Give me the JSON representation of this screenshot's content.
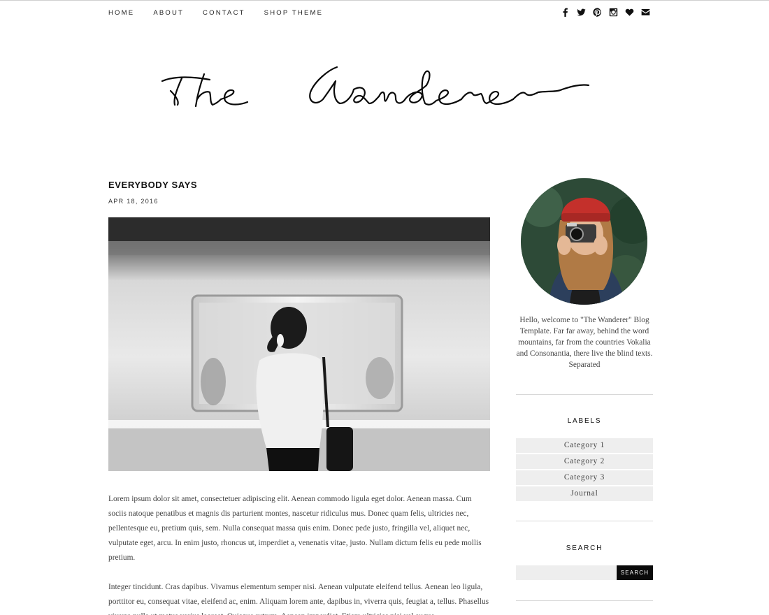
{
  "nav": {
    "items": [
      {
        "label": "HOME"
      },
      {
        "label": "ABOUT"
      },
      {
        "label": "CONTACT"
      },
      {
        "label": "SHOP THEME"
      }
    ],
    "social_icons": [
      "facebook-icon",
      "twitter-icon",
      "pinterest-icon",
      "instagram-icon",
      "heart-icon",
      "email-icon"
    ]
  },
  "blog": {
    "title": "The Wanderer"
  },
  "post": {
    "title": "EVERYBODY SAYS",
    "date": "APR 18, 2016",
    "image": "woman-at-subway-platform-photo",
    "paragraphs": [
      "Lorem ipsum dolor sit amet, consectetuer adipiscing elit. Aenean commodo ligula eget dolor. Aenean massa. Cum sociis natoque penatibus et magnis dis parturient montes, nascetur ridiculus mus. Donec quam felis, ultricies nec, pellentesque eu, pretium quis, sem. Nulla consequat massa quis enim. Donec pede justo, fringilla vel, aliquet nec, vulputate eget, arcu. In enim justo, rhoncus ut, imperdiet a, venenatis vitae, justo. Nullam dictum felis eu pede mollis pretium.",
      "Integer tincidunt. Cras dapibus. Vivamus elementum semper nisi. Aenean vulputate eleifend tellus. Aenean leo ligula, porttitor eu, consequat vitae, eleifend ac, enim. Aliquam lorem ante, dapibus in, viverra quis, feugiat a, tellus. Phasellus viverra nulla ut metus varius laoreet. Quisque rutrum. Aenean imperdiet. Etiam ultricies nisi vel augue."
    ]
  },
  "sidebar": {
    "about_text": "Hello, welcome to \"The Wanderer\" Blog Template. Far far away, behind the word mountains, far from the countries Vokalia and Consonantia, there live the blind texts. Separated",
    "labels_title": "LABELS",
    "labels": [
      {
        "label": "Category 1"
      },
      {
        "label": "Category 2"
      },
      {
        "label": "Category 3"
      },
      {
        "label": "Journal"
      }
    ],
    "search_title": "SEARCH",
    "search_value": "",
    "search_button": "SEARCH"
  }
}
